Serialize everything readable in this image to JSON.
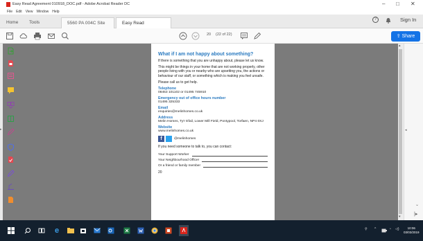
{
  "window": {
    "title": "Easy Read Agreement 010918_DOC.pdf - Adobe Acrobat Reader DC",
    "controls": {
      "minimize": "–",
      "maximize": "□",
      "close": "✕"
    }
  },
  "menu": {
    "items": [
      "File",
      "Edit",
      "View",
      "Window",
      "Help"
    ]
  },
  "tabs": {
    "home": "Home",
    "tools": "Tools",
    "doc1": "5560 PA 004C Site ...",
    "doc2": "Easy Read Agreemt...",
    "doc2_close": "✕"
  },
  "header_right": {
    "help_icon": "?",
    "bell_icon": "bell-icon",
    "signin": "Sign In"
  },
  "toolbar": {
    "page_current": "20",
    "page_total": "(22 of 22)",
    "share_label": "Share"
  },
  "page": {
    "heading": "What if I am not happy about something?",
    "para1": "If there is something that you are unhappy about, please let us know.",
    "para2": "This might be things in your home that are not working properly, other people living with you or nearby who are upsetting you, the actions or behaviour of our staff, or something which is making you feel unsafe.",
    "para3": "Please call us to get help.",
    "telephone_label": "Telephone",
    "telephone_value": "08453 101102 or 01495 745910",
    "emergency_label": "Emergency out of office hours number",
    "emergency_value": "01495 325333",
    "email_label": "Email",
    "email_value": "enquiries@melinhomes.co.uk",
    "address_label": "Address",
    "address_value": "Melin Homes, Ty'r Efail, Lower Mill Field, Pontypool, Torfaen, NP4 0XJ",
    "website_label": "Website",
    "website_value": "www.melinhomes.co.uk",
    "social_handle": "@melinhomes",
    "contact_intro": "If you need someone to talk to, you can contact:",
    "support_worker": "Your Support Worker",
    "neighbourhood_officer": "Your Neighbourhood Officer",
    "friend_family": "Or a friend or family member",
    "page_number": "20"
  },
  "taskbar": {
    "time": "10:06",
    "date": "03/03/2019",
    "tray_text": "ENG"
  },
  "colors": {
    "accent": "#1473e6",
    "heading_blue": "#2a7ac0",
    "taskbar": "#13202e",
    "doc_bg": "#7b7b7b"
  }
}
